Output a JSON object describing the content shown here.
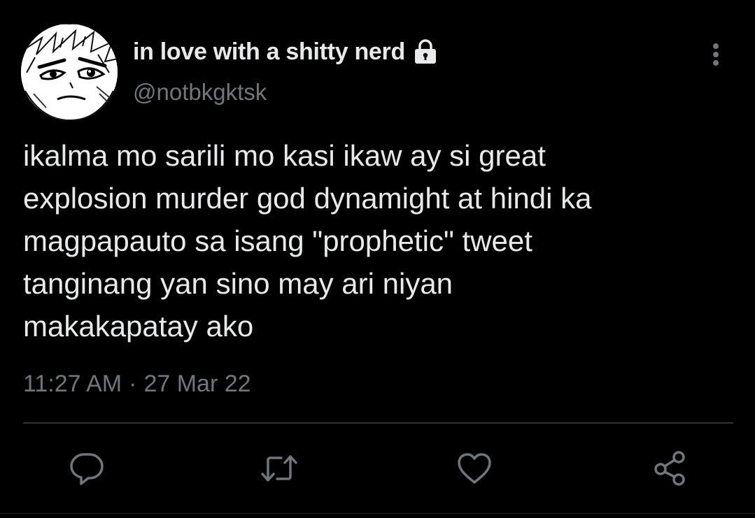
{
  "colors": {
    "background": "#000000",
    "primary_text": "#e7e9ea",
    "secondary_text": "#71767b",
    "divider": "#2f3336"
  },
  "tweet": {
    "author": {
      "display_name": "in love with a shitty nerd",
      "handle": "@notbkgktsk",
      "protected_icon": "lock-icon",
      "avatar_icon": "anime-avatar"
    },
    "text": "ikalma mo sarili mo kasi ikaw ay si great\nexplosion murder god dynamight at hindi ka\nmagpapauto sa isang \"prophetic\" tweet\ntanginang yan sino may ari niyan\nmakakapatay ako",
    "time": "11:27 AM",
    "separator": "·",
    "date": "27 Mar 22"
  },
  "actions": {
    "reply_icon": "reply-icon",
    "retweet_icon": "retweet-icon",
    "like_icon": "heart-icon",
    "share_icon": "share-icon"
  },
  "menu": {
    "icon": "more-vertical-icon"
  }
}
